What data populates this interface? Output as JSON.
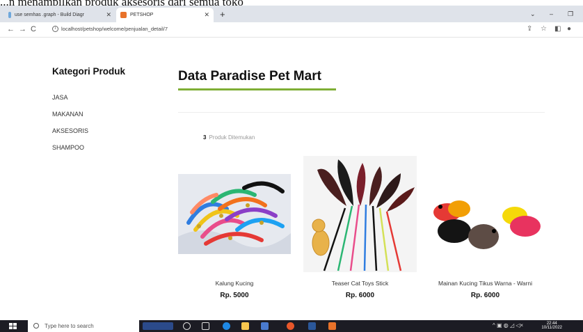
{
  "caption": "...n menampilkan produk aksesoris dari semua toko",
  "browser": {
    "tabs": [
      {
        "label": "use semhas .graph - Build Diagr"
      },
      {
        "label": "PETSHOP"
      }
    ],
    "url": "localhost/petshop/welcome/penjualan_detail/7"
  },
  "sidebar": {
    "title": "Kategori Produk",
    "items": [
      {
        "label": "JASA"
      },
      {
        "label": "MAKANAN"
      },
      {
        "label": "AKSESORIS"
      },
      {
        "label": "SHAMPOO"
      }
    ]
  },
  "main": {
    "title": "Data Paradise Pet Mart",
    "count": "3",
    "count_label": "Produk Ditemukan"
  },
  "products": [
    {
      "name": "Kalung Kucing",
      "price": "Rp. 5000"
    },
    {
      "name": "Teaser Cat Toys Stick",
      "price": "Rp. 6000"
    },
    {
      "name": "Mainan Kucing Tikus Warna - Warni",
      "price": "Rp. 6000"
    }
  ],
  "taskbar": {
    "search_placeholder": "Type here to search",
    "time": "22:44",
    "date": "10/11/2022"
  },
  "colors": {
    "accent": "#7fae35",
    "tab_bar": "#dfe3ea",
    "taskbar": "#1c1c24"
  }
}
